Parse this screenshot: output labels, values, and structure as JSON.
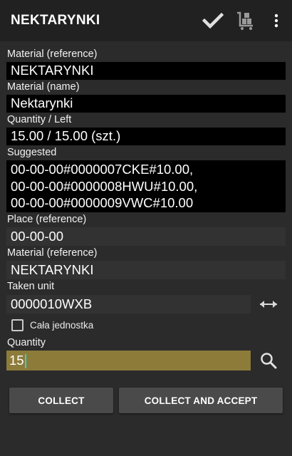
{
  "appbar": {
    "title": "NEKTARYNKI",
    "icons": [
      "check-icon",
      "cart-icon",
      "overflow-menu-icon"
    ]
  },
  "form": {
    "material_reference": {
      "label": "Material (reference)",
      "value": "NEKTARYNKI"
    },
    "material_name": {
      "label": "Material (name)",
      "value": "Nektarynki"
    },
    "quantity_left": {
      "label": "Quantity / Left",
      "value": "15.00 / 15.00 (szt.)"
    },
    "suggested": {
      "label": "Suggested",
      "lines": [
        "00-00-00#0000007CKE#10.00,",
        "00-00-00#0000008HWU#10.00,",
        "00-00-00#0000009VWC#10.00"
      ]
    },
    "place_reference": {
      "label": "Place (reference)",
      "value": "00-00-00"
    },
    "material_reference_2": {
      "label": "Material (reference)",
      "value": "NEKTARYNKI"
    },
    "taken_unit": {
      "label": "Taken unit",
      "value": "0000010WXB"
    },
    "whole_unit_checkbox": {
      "label": "Cała jednostka",
      "checked": false
    },
    "quantity": {
      "label": "Quantity",
      "value": "15"
    }
  },
  "buttons": {
    "collect": "COLLECT",
    "collect_and_accept": "COLLECT AND ACCEPT"
  },
  "colors": {
    "background": "#2b2b2b",
    "appbar": "#212121",
    "field_black": "#000000",
    "field_readonly": "#323232",
    "quantity_highlight": "#8d7b3a",
    "button": "#4a4a4a"
  }
}
